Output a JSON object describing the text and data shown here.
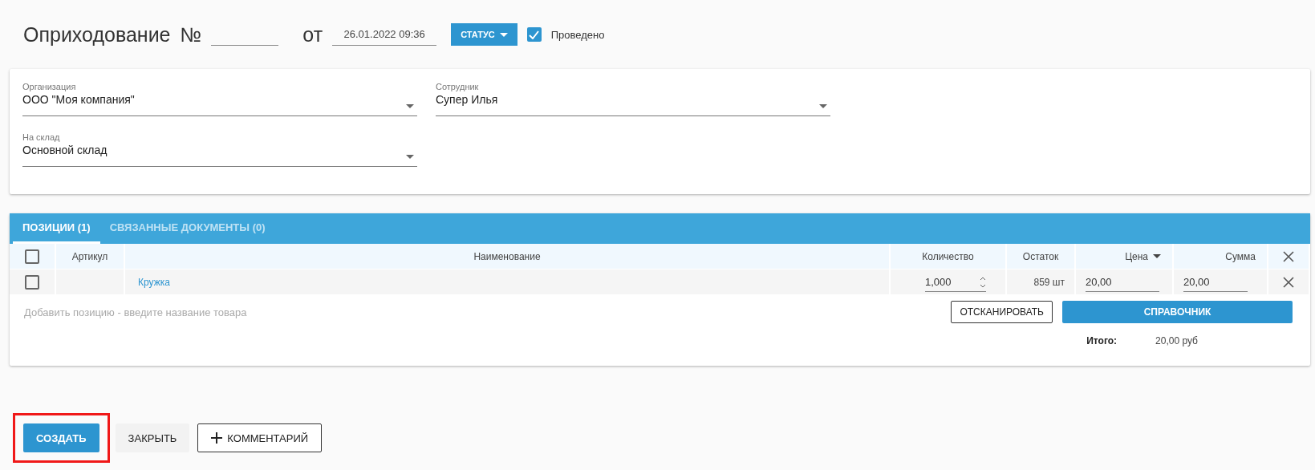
{
  "header": {
    "title": "Оприходование",
    "number_label": "№",
    "date_label": "от",
    "date_value": "26.01.2022 09:36",
    "status_button": "СТАТУС",
    "posted": {
      "label": "Проведено",
      "checked": true
    }
  },
  "form": [
    {
      "label": "Организация",
      "value": "ООО \"Моя компания\""
    },
    {
      "label": "Сотрудник",
      "value": "Супер Илья"
    },
    {
      "label": "На склад",
      "value": "Основной склад"
    }
  ],
  "tabs": [
    {
      "label": "ПОЗИЦИИ (1)",
      "selected": true
    },
    {
      "label": "СВЯЗАННЫЕ ДОКУМЕНТЫ (0)",
      "selected": false
    }
  ],
  "table": {
    "all_checked": false,
    "columns": [
      "Артикул",
      "Наименование",
      "Количество",
      "Остаток",
      "Цена",
      "Сумма"
    ],
    "rows": [
      {
        "checked": false,
        "name": "Кружка",
        "quantity": "1,000",
        "stock": "859 шт",
        "price": "20,00",
        "sum": "20,00"
      }
    ]
  },
  "add_placeholder": "Добавить позицию - введите название товара",
  "scan_button": "ОТСКАНИРОВАТЬ",
  "catalog_button": "СПРАВОЧНИК",
  "total": {
    "label": "Итого:",
    "value": "20,00 руб"
  },
  "footer": [
    {
      "label": "СОЗДАТЬ",
      "kind": "primary",
      "highlighted": true
    },
    {
      "label": "ЗАКРЫТЬ",
      "kind": "flat",
      "highlighted": false
    },
    {
      "label": "КОММЕНТАРИЙ",
      "kind": "outlined",
      "highlighted": false
    }
  ]
}
